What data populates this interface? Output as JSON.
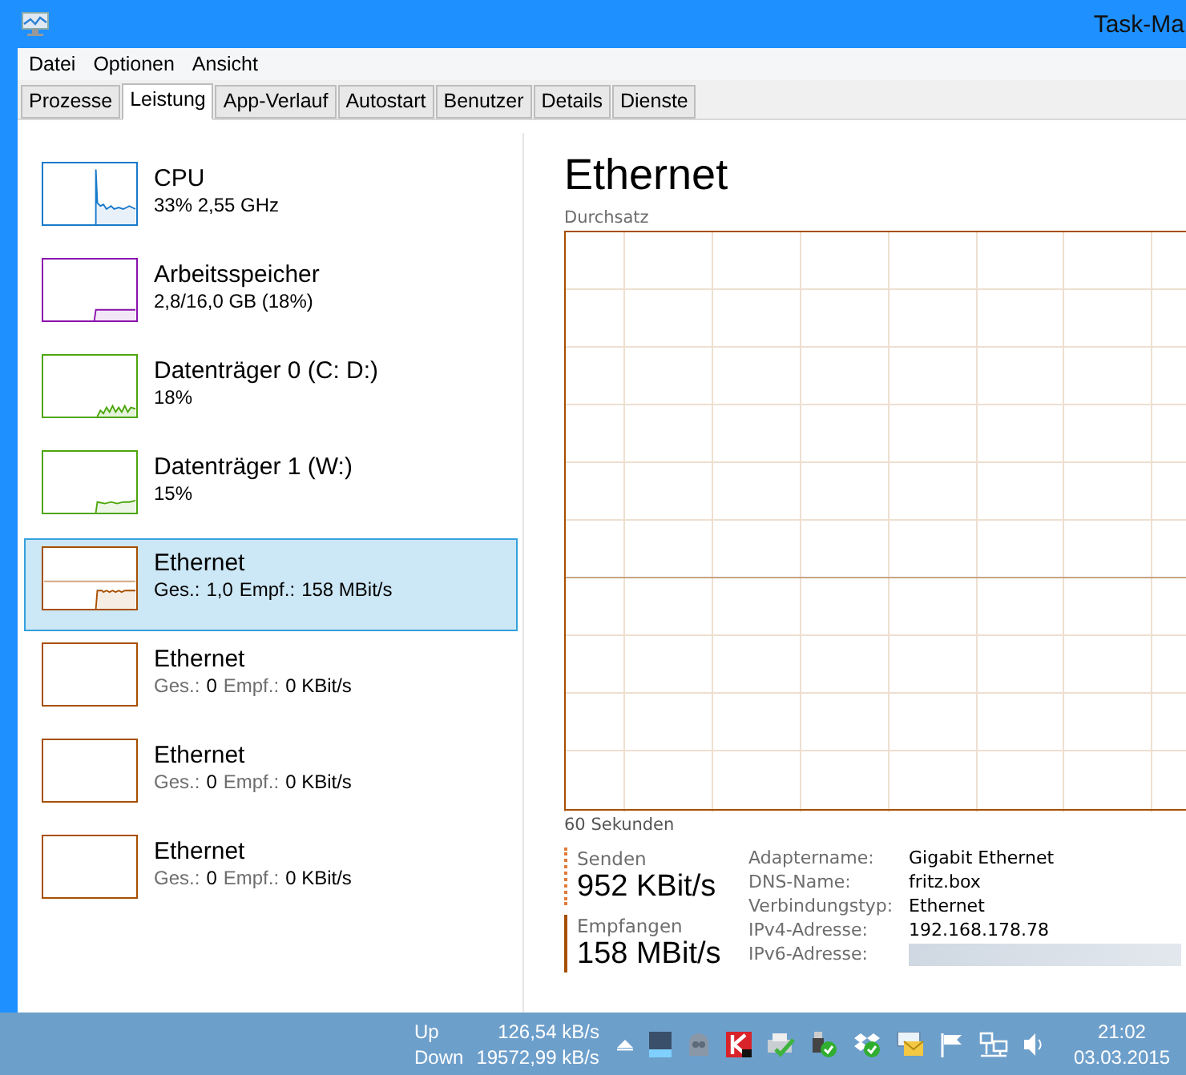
{
  "window": {
    "title": "Task-Ma"
  },
  "menu": [
    "Datei",
    "Optionen",
    "Ansicht"
  ],
  "tabs": [
    {
      "label": "Prozesse",
      "selected": false
    },
    {
      "label": "Leistung",
      "selected": true
    },
    {
      "label": "App-Verlauf",
      "selected": false
    },
    {
      "label": "Autostart",
      "selected": false
    },
    {
      "label": "Benutzer",
      "selected": false
    },
    {
      "label": "Details",
      "selected": false
    },
    {
      "label": "Dienste",
      "selected": false
    }
  ],
  "sidebar": {
    "items": [
      {
        "name": "CPU",
        "kind": "cpu",
        "color": "#1979ca",
        "selected": false,
        "detail": [
          {
            "text": "33%  2,55 GHz",
            "muted": false
          }
        ]
      },
      {
        "name": "Arbeitsspeicher",
        "kind": "memory",
        "color": "#8b12ae",
        "selected": false,
        "detail": [
          {
            "text": "2,8/16,0 GB (18%)",
            "muted": false
          }
        ]
      },
      {
        "name": "Datenträger 0 (C: D:)",
        "kind": "disk_busy",
        "color": "#4da60c",
        "selected": false,
        "detail": [
          {
            "text": "18%",
            "muted": false
          }
        ]
      },
      {
        "name": "Datenträger 1 (W:)",
        "kind": "disk_low",
        "color": "#4da60c",
        "selected": false,
        "detail": [
          {
            "text": "15%",
            "muted": false
          }
        ]
      },
      {
        "name": "Ethernet",
        "kind": "network",
        "color": "#a74f01",
        "selected": true,
        "detail": [
          {
            "text": "Ges.:",
            "muted": false
          },
          {
            "text": "1,0",
            "muted": false
          },
          {
            "text": "Empf.:",
            "muted": false
          },
          {
            "text": "158 MBit/s",
            "muted": false
          }
        ]
      },
      {
        "name": "Ethernet",
        "kind": "empty",
        "color": "#a74f01",
        "selected": false,
        "detail": [
          {
            "text": "Ges.:",
            "muted": true
          },
          {
            "text": "0",
            "muted": false
          },
          {
            "text": "Empf.:",
            "muted": true
          },
          {
            "text": "0 KBit/s",
            "muted": false
          }
        ]
      },
      {
        "name": "Ethernet",
        "kind": "empty",
        "color": "#a74f01",
        "selected": false,
        "detail": [
          {
            "text": "Ges.:",
            "muted": true
          },
          {
            "text": "0",
            "muted": false
          },
          {
            "text": "Empf.:",
            "muted": true
          },
          {
            "text": "0 KBit/s",
            "muted": false
          }
        ]
      },
      {
        "name": "Ethernet",
        "kind": "empty",
        "color": "#a74f01",
        "selected": false,
        "detail": [
          {
            "text": "Ges.:",
            "muted": true
          },
          {
            "text": "0",
            "muted": false
          },
          {
            "text": "Empf.:",
            "muted": true
          },
          {
            "text": "0 KBit/s",
            "muted": false
          }
        ]
      }
    ]
  },
  "main": {
    "title": "Ethernet",
    "graph_label": "Durchsatz",
    "time_label": "60 Sekunden",
    "send": {
      "label": "Senden",
      "value": "952 KBit/s"
    },
    "receive": {
      "label": "Empfangen",
      "value": "158 MBit/s"
    },
    "properties": [
      {
        "label": "Adaptername:",
        "value": "Gigabit Ethernet"
      },
      {
        "label": "DNS-Name:",
        "value": "fritz.box"
      },
      {
        "label": "Verbindungstyp:",
        "value": "Ethernet"
      },
      {
        "label": "IPv4-Adresse:",
        "value": "192.168.178.78"
      },
      {
        "label": "IPv6-Adresse:",
        "redacted": true
      }
    ]
  },
  "taskbar": {
    "up_label": "Up",
    "up_value": "126,54 kB/s",
    "down_label": "Down",
    "down_value": "19572,99 kB/s",
    "time": "21:02",
    "date": "03.03.2015"
  }
}
